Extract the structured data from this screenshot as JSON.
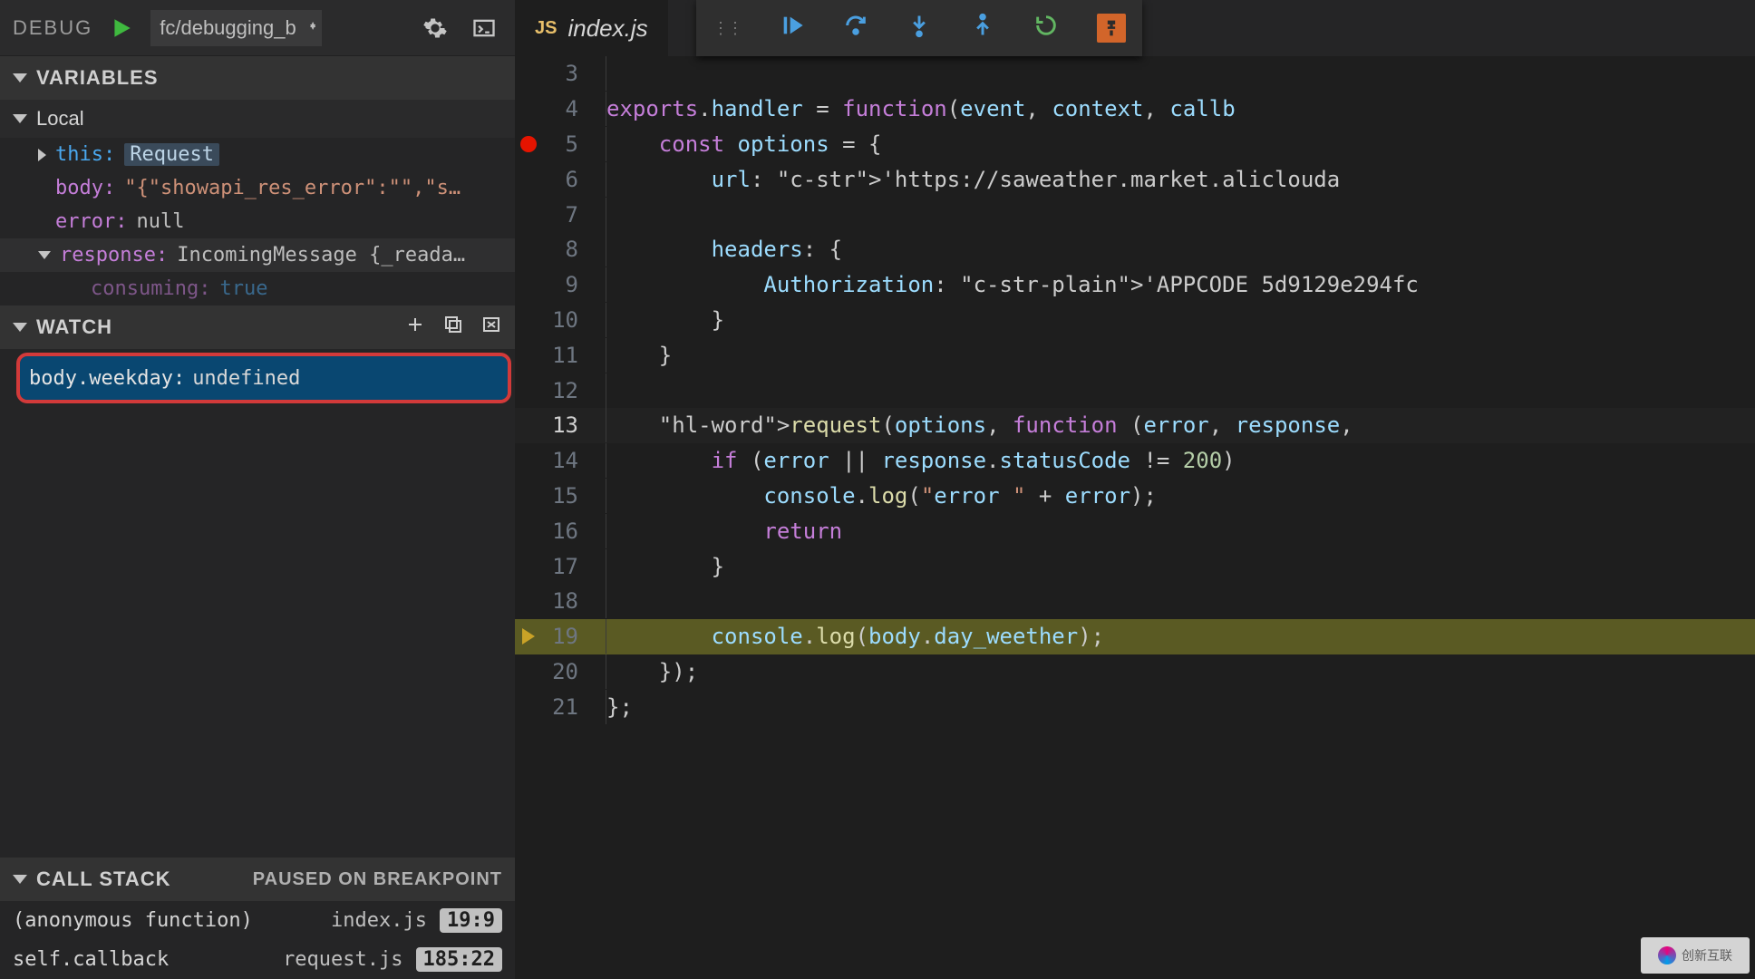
{
  "debug_bar": {
    "label": "DEBUG",
    "config": "fc/debugging_b"
  },
  "variables": {
    "header": "VARIABLES",
    "local_label": "Local",
    "items": {
      "this_k": "this:",
      "this_v": "Request",
      "body_k": "body:",
      "body_v": "\"{\"showapi_res_error\":\"\",\"s…",
      "error_k": "error:",
      "error_v": "null",
      "resp_k": "response:",
      "resp_v": "IncomingMessage {_reada…",
      "consuming_k": "consuming:",
      "consuming_v": "true"
    }
  },
  "watch": {
    "header": "WATCH",
    "item_expr": "body.weekday:",
    "item_val": "undefined"
  },
  "callstack": {
    "header": "CALL STACK",
    "paused": "PAUSED ON BREAKPOINT",
    "rows": [
      {
        "func": "(anonymous function)",
        "file": "index.js",
        "pos": "19:9"
      },
      {
        "func": "self.callback",
        "file": "request.js",
        "pos": "185:22"
      }
    ]
  },
  "tab": {
    "badge": "JS",
    "name": "index.js"
  },
  "code": {
    "lines": [
      {
        "n": "3",
        "raw": ""
      },
      {
        "n": "4",
        "raw": "exports.handler = function(event, context, callb"
      },
      {
        "n": "5",
        "raw": "    const options = {",
        "bp": true
      },
      {
        "n": "6",
        "raw": "        url: 'https://saweather.market.aliclouda"
      },
      {
        "n": "7",
        "raw": ""
      },
      {
        "n": "8",
        "raw": "        headers: {"
      },
      {
        "n": "9",
        "raw": "            Authorization: 'APPCODE 5d9129e294fc"
      },
      {
        "n": "10",
        "raw": "        }"
      },
      {
        "n": "11",
        "raw": "    }"
      },
      {
        "n": "12",
        "raw": ""
      },
      {
        "n": "13",
        "raw": "    request(options, function (error, response,",
        "cur": true
      },
      {
        "n": "14",
        "raw": "        if (error || response.statusCode != 200)"
      },
      {
        "n": "15",
        "raw": "            console.log(\"error \" + error);"
      },
      {
        "n": "16",
        "raw": "            return"
      },
      {
        "n": "17",
        "raw": "        }"
      },
      {
        "n": "18",
        "raw": ""
      },
      {
        "n": "19",
        "raw": "        console.log(body.day_weether);",
        "hl": true,
        "arrow": true
      },
      {
        "n": "20",
        "raw": "    });"
      },
      {
        "n": "21",
        "raw": "};"
      }
    ]
  },
  "watermark": "创新互联"
}
